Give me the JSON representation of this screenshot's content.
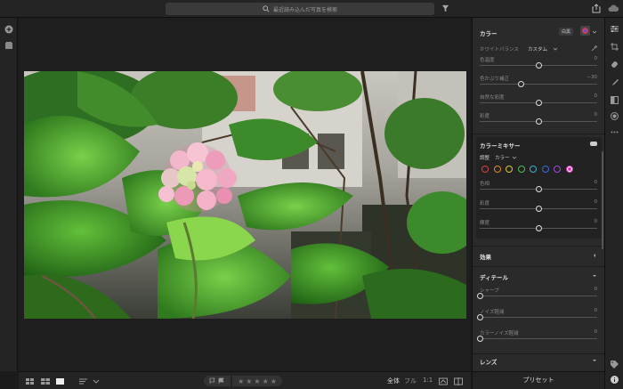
{
  "search": {
    "placeholder": "最近読み込んだ写真を検索"
  },
  "bottom": {
    "zoom_all": "全体",
    "zoom_full": "フル",
    "zoom_ratio": "1:1"
  },
  "panel": {
    "color_title": "カラー",
    "auto_label": "白黒",
    "wb_label": "ホワイトバランス",
    "wb_value": "カスタム",
    "sliders": [
      {
        "label": "色温度",
        "value": "0",
        "pos": 0.5
      },
      {
        "label": "色かぶり補正",
        "value": "−30",
        "pos": 0.35
      },
      {
        "label": "自然な彩度",
        "value": "0",
        "pos": 0.5
      },
      {
        "label": "彩度",
        "value": "0",
        "pos": 0.5
      }
    ],
    "mixer_title": "カラーミキサー",
    "adjust_label": "調整",
    "adjust_value": "カラー",
    "mixer_sliders": [
      {
        "label": "色相",
        "value": "0",
        "pos": 0.5
      },
      {
        "label": "彩度",
        "value": "0",
        "pos": 0.5
      },
      {
        "label": "輝度",
        "value": "0",
        "pos": 0.5
      }
    ],
    "mixer_colors": [
      "#e0403a",
      "#e08a2a",
      "#d8c52a",
      "#4cc04c",
      "#3ab0c8",
      "#3a6ae0",
      "#9a4ae0",
      "#e03ab8"
    ],
    "effects_title": "効果",
    "detail_title": "ディテール",
    "detail_sliders": [
      {
        "label": "シャープ",
        "value": "0",
        "pos": 0.0
      },
      {
        "label": "ノイズ軽減",
        "value": "0",
        "pos": 0.0
      },
      {
        "label": "カラーノイズ軽減",
        "value": "0",
        "pos": 0.0
      }
    ],
    "lens_title": "レンズ",
    "preset_label": "プリセット"
  }
}
